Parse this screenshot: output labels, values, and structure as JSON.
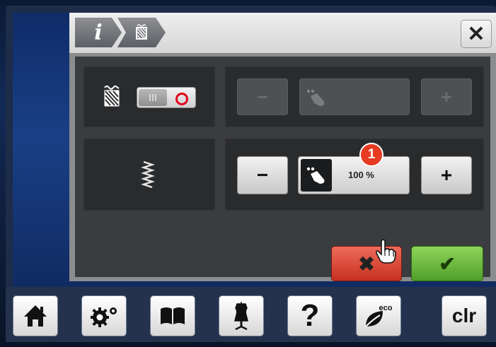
{
  "header": {
    "breadcrumb_info_label": "i",
    "close_label": "✕"
  },
  "controls": {
    "minus_label": "−",
    "plus_label": "+",
    "active_value": "100 %",
    "badge_number": "1"
  },
  "actions": {
    "cancel_label": "✖",
    "confirm_label": "✔"
  },
  "navbar": {
    "help_label": "?",
    "clear_label": "clr",
    "eco_label": "eco"
  },
  "colors": {
    "cancel": "#d9402e",
    "confirm": "#6cbf3c",
    "badge": "#e63a23",
    "toggle_indicator": "#e2001a"
  }
}
